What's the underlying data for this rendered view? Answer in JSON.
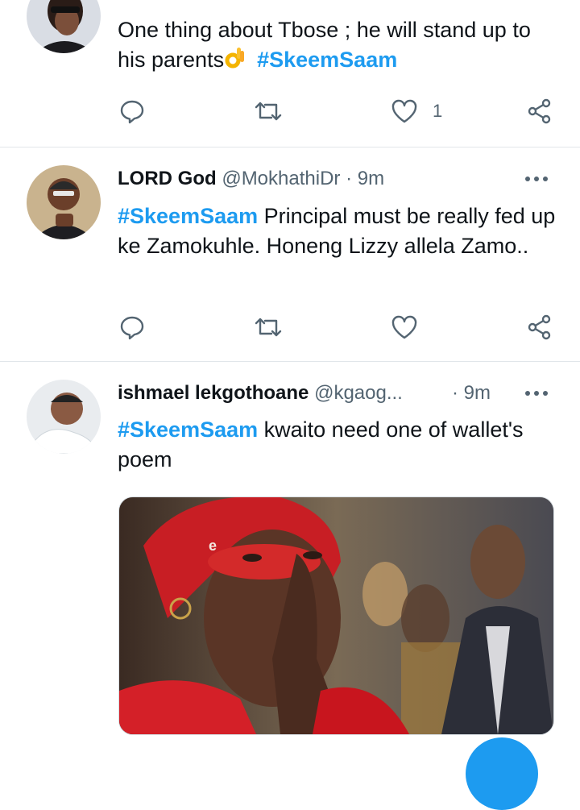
{
  "tweets": [
    {
      "text": "One thing about Tbose ; he will stand up to his parents",
      "emoji": "ok-hand",
      "hashtag": "#SkeemSaam",
      "likes": "1"
    },
    {
      "name": "LORD God",
      "handle": "@MokhathiDr",
      "dot": "·",
      "time": "9m",
      "hashtag": "#SkeemSaam",
      "text": " Principal must be really fed up ke Zamokuhle. Honeng Lizzy allela Zamo.."
    },
    {
      "name": "ishmael lekgothoane",
      "handle": "@kgaog...",
      "dot": "·",
      "time": "9m",
      "hashtag": "#SkeemSaam",
      "text": " kwaito need one of wallet's poem",
      "media": {
        "watermark": "e"
      }
    }
  ],
  "icons": {
    "reply": "reply-icon",
    "retweet": "retweet-icon",
    "like": "heart-icon",
    "share": "share-icon",
    "more": "more-icon",
    "compose": "compose-fab"
  },
  "colors": {
    "accent": "#1d9bf0",
    "text": "#0f1419",
    "muted": "#536471",
    "divider": "#e1e6ea"
  }
}
